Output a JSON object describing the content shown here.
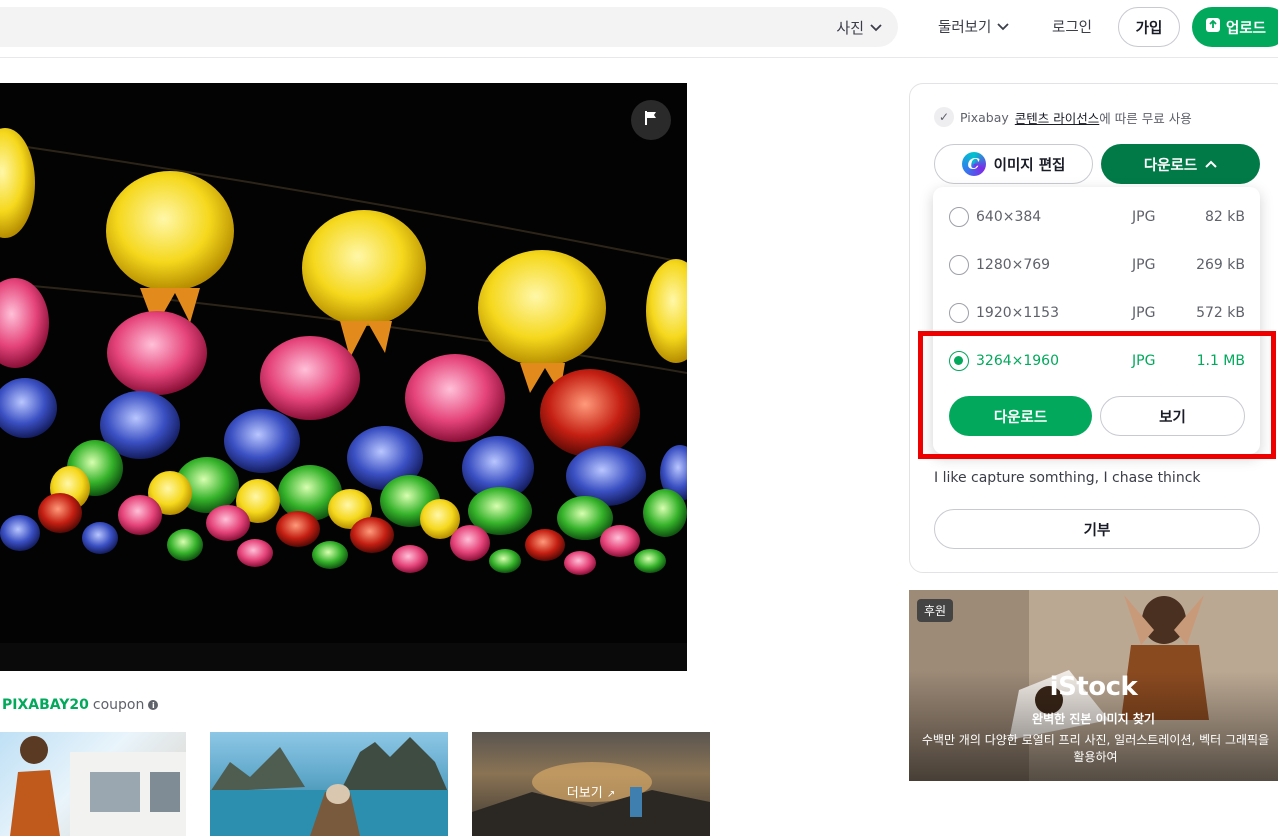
{
  "header": {
    "search_type": "사진",
    "explore": "둘러보기",
    "login": "로그인",
    "join": "가입",
    "upload": "업로드"
  },
  "colors": {
    "brand_green": "#02a95c",
    "dark_green": "#027a48",
    "highlight_red": "#ee0000"
  },
  "coupon": {
    "code": "PIXABAY20",
    "label": "coupon"
  },
  "thumbs": {
    "more_label": "더보기"
  },
  "panel": {
    "license_prefix": "Pixabay",
    "license_link": "콘텐츠 라이선스",
    "license_suffix": "에 따른 무료 사용",
    "edit_button": "이미지 편집",
    "download_button": "다운로드",
    "options": [
      {
        "dimensions": "640×384",
        "format": "JPG",
        "size": "82 kB",
        "selected": false
      },
      {
        "dimensions": "1280×769",
        "format": "JPG",
        "size": "269 kB",
        "selected": false
      },
      {
        "dimensions": "1920×1153",
        "format": "JPG",
        "size": "572 kB",
        "selected": false
      },
      {
        "dimensions": "3264×1960",
        "format": "JPG",
        "size": "1.1 MB",
        "selected": true
      }
    ],
    "dropdown_download": "다운로드",
    "dropdown_view": "보기",
    "bio": "I like capture somthing, I chase thinck",
    "donate": "기부"
  },
  "ad": {
    "badge": "후원",
    "logo": "iStock",
    "title": "완벽한 진본 이미지 찾기",
    "description": "수백만 개의 다양한 로열티 프리 사진, 일러스트레이션, 벡터 그래픽을 활용하여"
  }
}
